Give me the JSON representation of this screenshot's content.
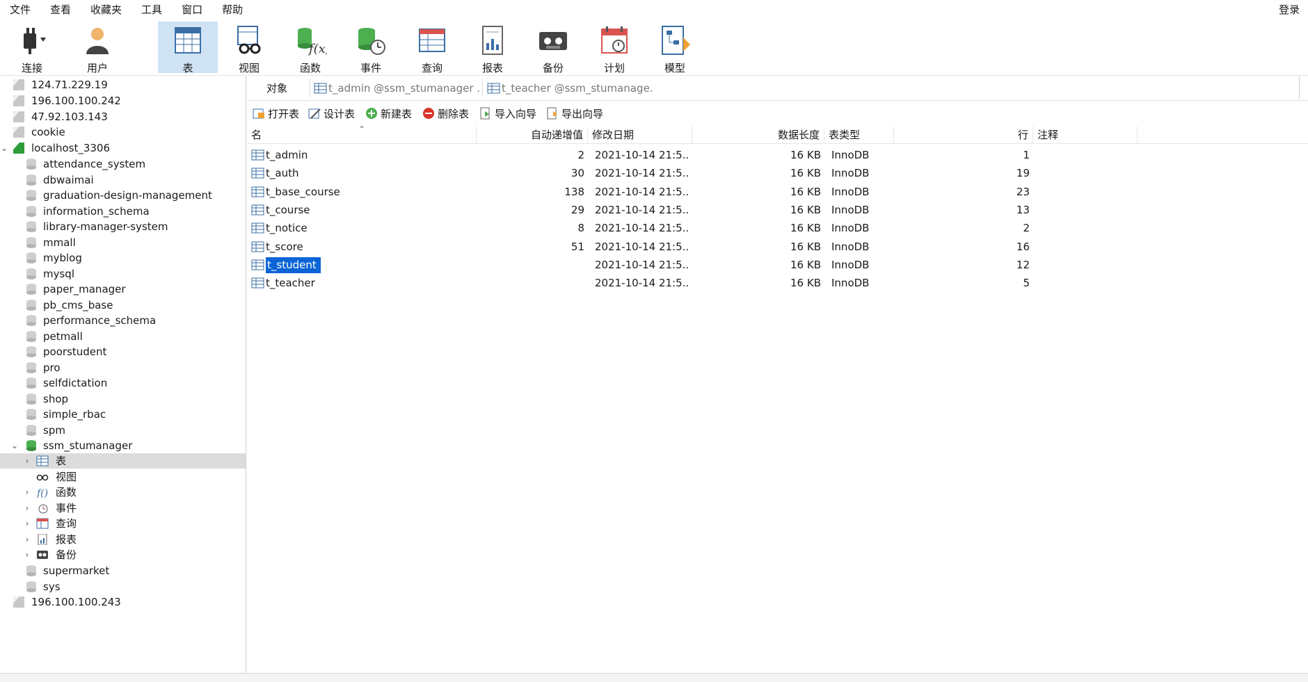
{
  "menu": {
    "items": [
      "文件",
      "查看",
      "收藏夹",
      "工具",
      "窗口",
      "帮助"
    ],
    "login": "登录"
  },
  "toolbar": {
    "buttons": [
      {
        "label": "连接",
        "icon": "plug-icon"
      },
      {
        "label": "用户",
        "icon": "user-icon"
      },
      {
        "label": "表",
        "icon": "table-icon",
        "active": true
      },
      {
        "label": "视图",
        "icon": "view-icon"
      },
      {
        "label": "函数",
        "icon": "function-icon"
      },
      {
        "label": "事件",
        "icon": "event-icon"
      },
      {
        "label": "查询",
        "icon": "query-icon"
      },
      {
        "label": "报表",
        "icon": "report-icon"
      },
      {
        "label": "备份",
        "icon": "backup-icon"
      },
      {
        "label": "计划",
        "icon": "schedule-icon"
      },
      {
        "label": "模型",
        "icon": "model-icon"
      }
    ]
  },
  "sidebar": {
    "connections_top": [
      "124.71.229.19",
      "196.100.100.242",
      "47.92.103.143",
      "cookie"
    ],
    "localhost": "localhost_3306",
    "databases_before": [
      "attendance_system",
      "dbwaimai",
      "graduation-design-management",
      "information_schema",
      "library-manager-system",
      "mmall",
      "myblog",
      "mysql",
      "paper_manager",
      "pb_cms_base",
      "performance_schema",
      "petmall",
      "poorstudent",
      "pro",
      "selfdictation",
      "shop",
      "simple_rbac",
      "spm"
    ],
    "open_db": "ssm_stumanager",
    "children": [
      "表",
      "视图",
      "函数",
      "事件",
      "查询",
      "报表",
      "备份"
    ],
    "databases_after": [
      "supermarket",
      "sys"
    ],
    "connection_bottom": "196.100.100.243"
  },
  "tabs": {
    "objects": "对象",
    "tab1": "t_admin @ssm_stumanager ...",
    "tab2": "t_teacher @ssm_stumanage..."
  },
  "actions": [
    "打开表",
    "设计表",
    "新建表",
    "删除表",
    "导入向导",
    "导出向导"
  ],
  "grid": {
    "headers": [
      "名",
      "自动递增值",
      "修改日期",
      "数据长度",
      "表类型",
      "行",
      "注释"
    ],
    "rows": [
      {
        "name": "t_admin",
        "auto": "2",
        "date": "2021-10-14 21:5...",
        "size": "16 KB",
        "engine": "InnoDB",
        "rows": "1"
      },
      {
        "name": "t_auth",
        "auto": "30",
        "date": "2021-10-14 21:5...",
        "size": "16 KB",
        "engine": "InnoDB",
        "rows": "19"
      },
      {
        "name": "t_base_course",
        "auto": "138",
        "date": "2021-10-14 21:5...",
        "size": "16 KB",
        "engine": "InnoDB",
        "rows": "23"
      },
      {
        "name": "t_course",
        "auto": "29",
        "date": "2021-10-14 21:5...",
        "size": "16 KB",
        "engine": "InnoDB",
        "rows": "13"
      },
      {
        "name": "t_notice",
        "auto": "8",
        "date": "2021-10-14 21:5...",
        "size": "16 KB",
        "engine": "InnoDB",
        "rows": "2"
      },
      {
        "name": "t_score",
        "auto": "51",
        "date": "2021-10-14 21:5...",
        "size": "16 KB",
        "engine": "InnoDB",
        "rows": "16"
      },
      {
        "name": "t_student",
        "auto": "",
        "date": "2021-10-14 21:5...",
        "size": "16 KB",
        "engine": "InnoDB",
        "rows": "12",
        "selected": true
      },
      {
        "name": "t_teacher",
        "auto": "",
        "date": "2021-10-14 21:5...",
        "size": "16 KB",
        "engine": "InnoDB",
        "rows": "5"
      }
    ]
  },
  "colors": {
    "selected_tab": "#cfe3f5",
    "selection": "#0a64d6",
    "sidebar_selected": "#dcdcdc"
  }
}
